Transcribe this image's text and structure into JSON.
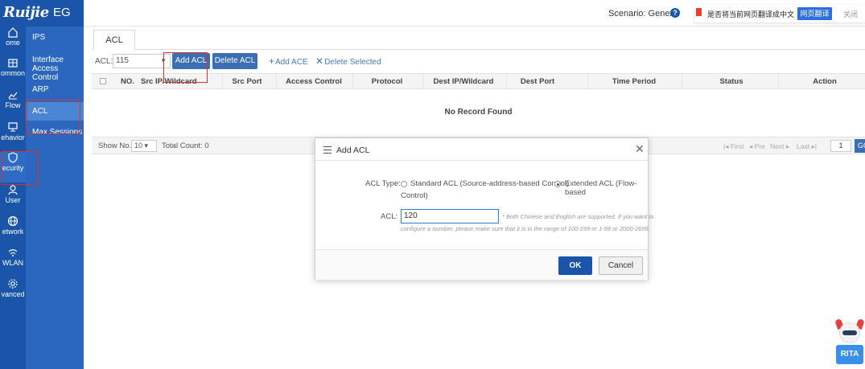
{
  "brand": {
    "logo": "Ruijie",
    "product": "EG"
  },
  "header": {
    "scenario_label": "Scenario: General",
    "help_icon": "question-circle-icon"
  },
  "translate_bar": {
    "prompt": "是否将当前网页翻译成中文",
    "translate_button": "网页翻译",
    "close": "关闭"
  },
  "sidebar": {
    "items": [
      {
        "label": "ome",
        "icon": "home-icon"
      },
      {
        "label": "ommon",
        "icon": "common-icon"
      },
      {
        "label": "Flow",
        "icon": "flow-icon"
      },
      {
        "label": "ehavior",
        "icon": "behavior-icon"
      },
      {
        "label": "ecurity",
        "icon": "shield-icon"
      },
      {
        "label": "User",
        "icon": "user-icon"
      },
      {
        "label": "etwork",
        "icon": "network-icon"
      },
      {
        "label": "WLAN",
        "icon": "wlan-icon"
      },
      {
        "label": "vanced",
        "icon": "gear-icon"
      }
    ]
  },
  "subnav": {
    "items": [
      {
        "label": "IPS"
      },
      {
        "label": "Interface Access Control"
      },
      {
        "label": "ARP"
      },
      {
        "label": "ACL"
      },
      {
        "label": "Max Sessions"
      }
    ]
  },
  "tabs": [
    {
      "label": "ACL"
    }
  ],
  "toolbar": {
    "acl_label": "ACL:",
    "acl_value": "115",
    "add_acl": "Add ACL",
    "delete_acl": "Delete ACL",
    "add_ace": "Add ACE",
    "delete_selected": "Delete Selected"
  },
  "table": {
    "columns": [
      "NO.",
      "Src IP/Wildcard",
      "Src Port",
      "Access Control",
      "Protocol",
      "Dest IP/Wildcard",
      "Dest Port",
      "Time Period",
      "Status",
      "Action"
    ],
    "empty_text": "No Record Found"
  },
  "pager": {
    "show_no_label": "Show No.:",
    "page_size": "10",
    "total_label": "Total Count: 0",
    "first": "First",
    "prev": "Pre",
    "next": "Next",
    "last": "Last",
    "page": "1",
    "go": "GO"
  },
  "modal": {
    "title": "Add ACL",
    "acl_type_label": "ACL Type:",
    "standard_option": "Standard ACL (Source-address-based Control)",
    "extended_option_line1": "Extended ACL (Flow-based",
    "extended_option_line2": "Control)",
    "selected_type": "extended",
    "acl_label": "ACL:",
    "acl_value": "120",
    "hint_line1": "* Both Chinese and English are supported. If you want to",
    "hint_line2": "configure a number, please make sure that it is in the range of 100-199 or 1-99 or 2000-2699.",
    "ok": "OK",
    "cancel": "Cancel"
  },
  "assistant": {
    "label": "RITA"
  },
  "colors": {
    "primary": "#1a55a9",
    "subnav": "#2b67be",
    "highlight": "#e0302c",
    "input_focus": "#2e7fd2"
  }
}
